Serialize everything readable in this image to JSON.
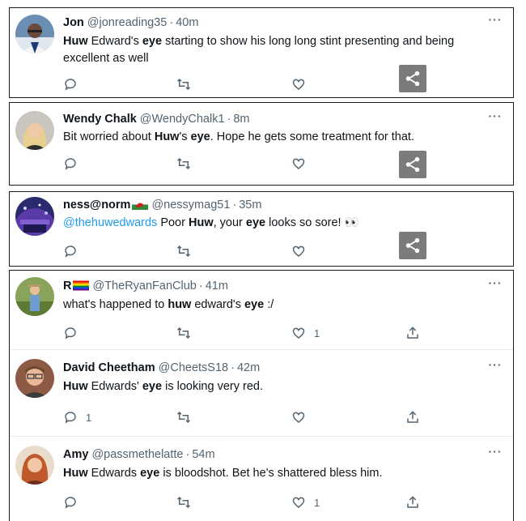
{
  "tweets": [
    {
      "name": "Jon",
      "handle": "@jonreading35",
      "time": "40m",
      "body": [
        {
          "t": "Huw",
          "b": true
        },
        {
          "t": " Edward's ",
          "b": false
        },
        {
          "t": "eye",
          "b": true
        },
        {
          "t": " starting to show his long long stint presenting and being excellent as well",
          "b": false
        }
      ],
      "replies": "",
      "retweets": "",
      "likes": ""
    },
    {
      "name": "Wendy Chalk",
      "handle": "@WendyChalk1",
      "time": "8m",
      "body": [
        {
          "t": "Bit worried about ",
          "b": false
        },
        {
          "t": "Huw",
          "b": true
        },
        {
          "t": "'s ",
          "b": false
        },
        {
          "t": "eye",
          "b": true
        },
        {
          "t": ". Hope he gets some treatment for that.",
          "b": false
        }
      ],
      "replies": "",
      "retweets": "",
      "likes": ""
    },
    {
      "name": "ness@norm",
      "handle": "@nessymag51",
      "time": "35m",
      "body": [
        {
          "t": "@thehuwedwards",
          "b": false,
          "m": true
        },
        {
          "t": " Poor ",
          "b": false
        },
        {
          "t": "Huw",
          "b": true
        },
        {
          "t": ", your ",
          "b": false
        },
        {
          "t": "eye",
          "b": true
        },
        {
          "t": " looks so sore! 👀",
          "b": false
        }
      ],
      "replies": "",
      "retweets": "",
      "likes": ""
    },
    {
      "name": "R",
      "handle": "@TheRyanFanClub",
      "time": "41m",
      "body": [
        {
          "t": "what's happened to ",
          "b": false
        },
        {
          "t": "huw",
          "b": true
        },
        {
          "t": " edward's ",
          "b": false
        },
        {
          "t": "eye",
          "b": true
        },
        {
          "t": " :/",
          "b": false
        }
      ],
      "replies": "",
      "retweets": "",
      "likes": "1"
    },
    {
      "name": "David Cheetham",
      "handle": "@CheetsS18",
      "time": "42m",
      "body": [
        {
          "t": "Huw",
          "b": true
        },
        {
          "t": " Edwards' ",
          "b": false
        },
        {
          "t": "eye",
          "b": true
        },
        {
          "t": " is looking very red.",
          "b": false
        }
      ],
      "replies": "1",
      "retweets": "",
      "likes": ""
    },
    {
      "name": "Amy",
      "handle": "@passmethelatte",
      "time": "54m",
      "body": [
        {
          "t": "Huw",
          "b": true
        },
        {
          "t": " Edwards ",
          "b": false
        },
        {
          "t": "eye",
          "b": true
        },
        {
          "t": " is bloodshot. Bet he's shattered bless him.",
          "b": false
        }
      ],
      "replies": "",
      "retweets": "",
      "likes": "1"
    }
  ],
  "ui": {
    "dot": "·",
    "more": "···"
  },
  "colors": {
    "text": "#0f1419",
    "muted": "#536471",
    "link": "#1d9bf0",
    "share_overlay": "#7b7b7b"
  },
  "icons": [
    "reply-icon",
    "retweet-icon",
    "like-icon",
    "share-icon",
    "more-icon"
  ]
}
